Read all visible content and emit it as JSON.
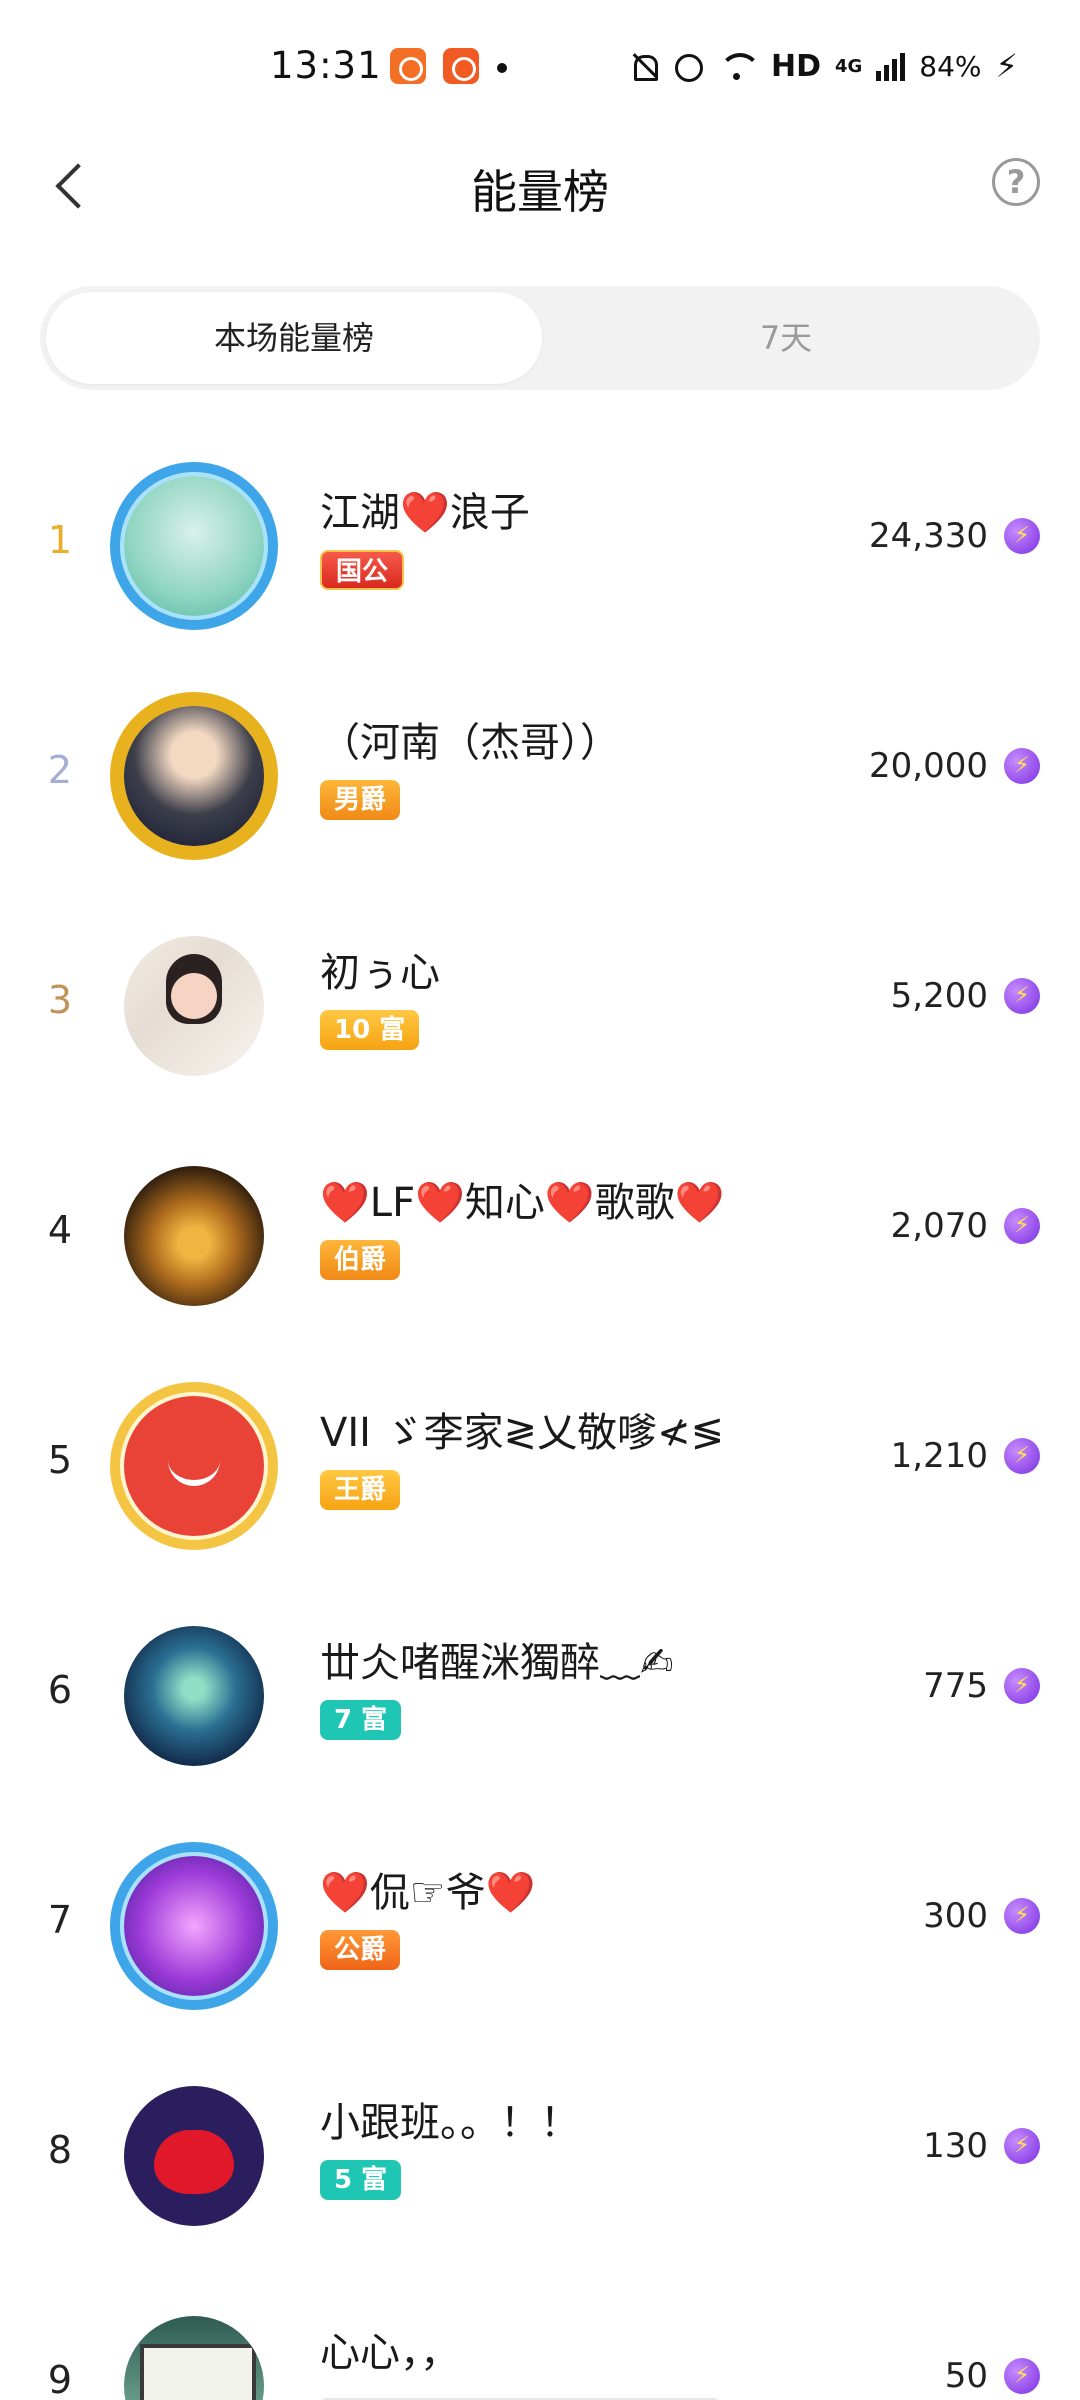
{
  "status_bar": {
    "time": "13:31",
    "network": "HD",
    "network_type": "4G",
    "battery": "84%"
  },
  "header": {
    "title": "能量榜",
    "back_icon": "chevron-left-icon",
    "help_icon": "question-circle-icon",
    "help_glyph": "?"
  },
  "tabs": [
    {
      "label": "本场能量榜",
      "active": true
    },
    {
      "label": "7天",
      "active": false
    }
  ],
  "energy_icon": "lightning-energy-icon",
  "rows": [
    {
      "rank": "1",
      "name": "江湖❤️浪子",
      "badge": "国公",
      "score": "24,330"
    },
    {
      "rank": "2",
      "name": "（河南（杰哥））",
      "badge": "男爵",
      "score": "20,000"
    },
    {
      "rank": "3",
      "name": "初ぅ心",
      "badge": "10 富",
      "score": "5,200"
    },
    {
      "rank": "4",
      "name": "❤️LF❤️知心❤️歌歌❤️",
      "badge": "伯爵",
      "score": "2,070"
    },
    {
      "rank": "5",
      "name": "VII ゞ李家≷乂敬嗲≮≶",
      "badge": "王爵",
      "score": "1,210"
    },
    {
      "rank": "6",
      "name": "丗仌啫醒洣獨醉﹏✍",
      "badge": "7 富",
      "score": "775"
    },
    {
      "rank": "7",
      "name": "❤️侃☞爷❤️",
      "badge": "公爵",
      "score": "300"
    },
    {
      "rank": "8",
      "name": "小跟班。。！！",
      "badge": "5 富",
      "score": "130"
    },
    {
      "rank": "9",
      "name": "心心，，",
      "badge": "",
      "score": "50"
    }
  ]
}
